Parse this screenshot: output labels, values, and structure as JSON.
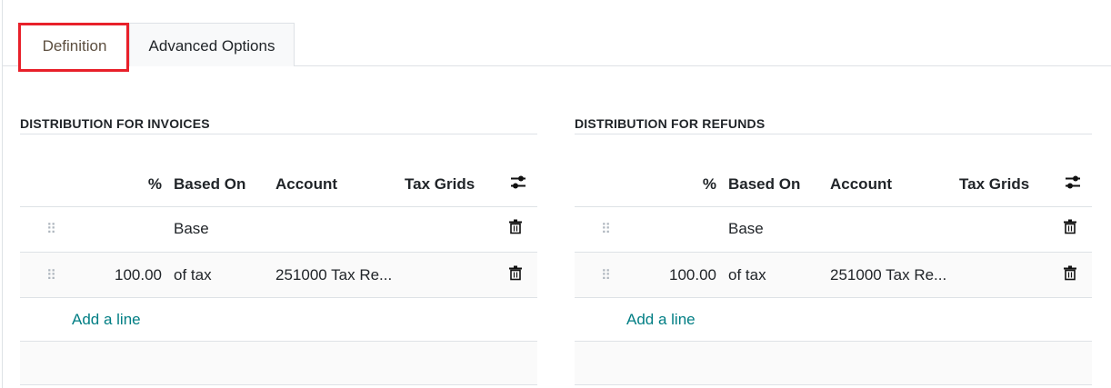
{
  "tabs": [
    {
      "label": "Definition",
      "active": true
    },
    {
      "label": "Advanced Options",
      "active": false
    }
  ],
  "sections": [
    {
      "title": "DISTRIBUTION FOR INVOICES",
      "headers": {
        "percent": "%",
        "based_on": "Based On",
        "account": "Account",
        "tax_grids": "Tax Grids"
      },
      "rows": [
        {
          "percent": "",
          "based_on": "Base",
          "account": "",
          "tax_grids": ""
        },
        {
          "percent": "100.00",
          "based_on": "of tax",
          "account": "251000 Tax Re...",
          "tax_grids": ""
        }
      ],
      "add_line": "Add a line"
    },
    {
      "title": "DISTRIBUTION FOR REFUNDS",
      "headers": {
        "percent": "%",
        "based_on": "Based On",
        "account": "Account",
        "tax_grids": "Tax Grids"
      },
      "rows": [
        {
          "percent": "",
          "based_on": "Base",
          "account": "",
          "tax_grids": ""
        },
        {
          "percent": "100.00",
          "based_on": "of tax",
          "account": "251000 Tax Re...",
          "tax_grids": ""
        }
      ],
      "add_line": "Add a line"
    }
  ],
  "colors": {
    "accent": "#017e84",
    "highlight": "#e8202a"
  }
}
